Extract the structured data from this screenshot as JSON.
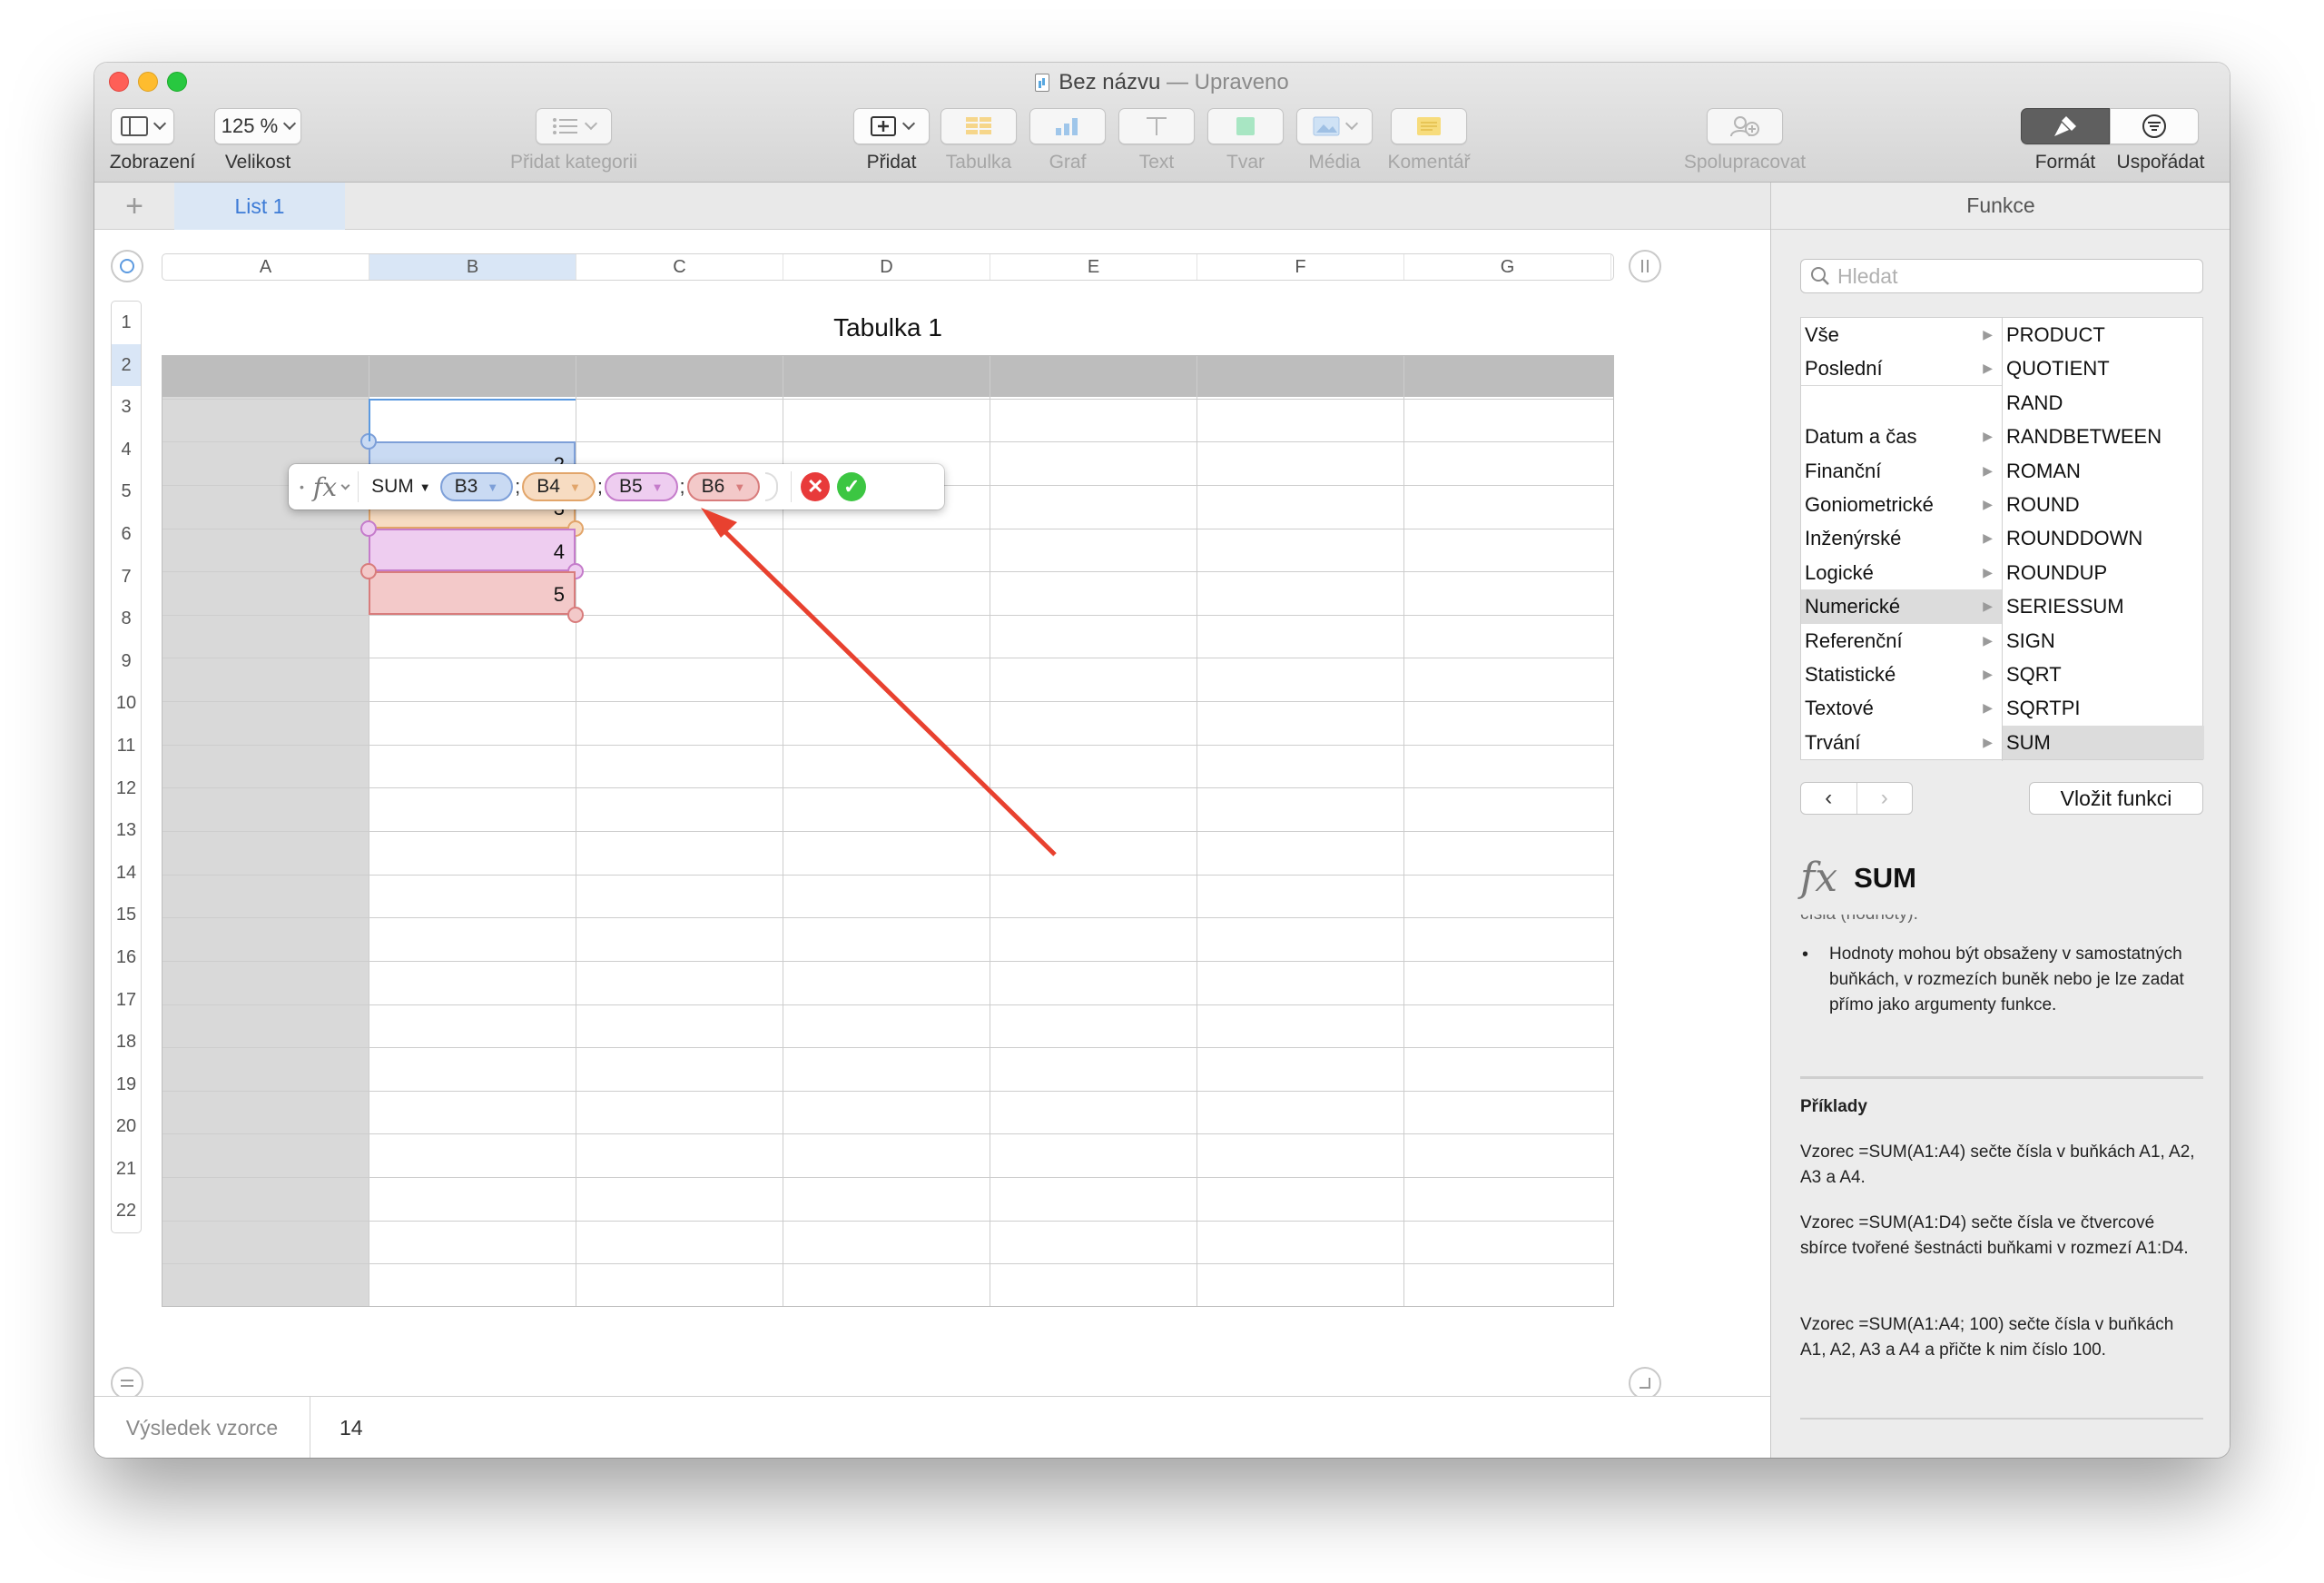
{
  "window": {
    "title": "Bez názvu",
    "title_sep": "—",
    "subtitle": "Upraveno"
  },
  "toolbar": {
    "zoom_value": "125 %",
    "labels": {
      "view": "Zobrazení",
      "zoom": "Velikost",
      "category": "Přidat kategorii",
      "insert": "Přidat",
      "table": "Tabulka",
      "chart": "Graf",
      "text": "Text",
      "shape": "Tvar",
      "media": "Média",
      "comment": "Komentář",
      "collaborate": "Spolupracovat",
      "format": "Formát",
      "organize": "Uspořádat"
    }
  },
  "sheets": {
    "add": "+",
    "active": "List 1"
  },
  "table": {
    "title": "Tabulka 1",
    "columns": [
      "A",
      "B",
      "C",
      "D",
      "E",
      "F",
      "G"
    ],
    "rows": [
      "1",
      "2",
      "3",
      "4",
      "5",
      "6",
      "7",
      "8",
      "9",
      "10",
      "11",
      "12",
      "13",
      "14",
      "15",
      "16",
      "17",
      "18",
      "19",
      "20",
      "21",
      "22"
    ],
    "values": {
      "B3": "2",
      "B4": "3",
      "B5": "4",
      "B6": "5"
    }
  },
  "formula_editor": {
    "dot": "•",
    "fx": "fx",
    "function": "SUM",
    "args": [
      {
        "ref": "B3",
        "color": "#c9daf3",
        "border": "#7d9fd8"
      },
      {
        "ref": "B4",
        "color": "#f7dcc2",
        "border": "#e2a56a"
      },
      {
        "ref": "B5",
        "color": "#eecdf0",
        "border": "#c57ccb"
      },
      {
        "ref": "B6",
        "color": "#f3c9c9",
        "border": "#d87c7c"
      }
    ],
    "separator": ";"
  },
  "statusbar": {
    "label": "Výsledek vzorce",
    "value": "14"
  },
  "panel": {
    "title": "Funkce",
    "search_placeholder": "Hledat",
    "categories": [
      "Vše",
      "Poslední",
      "",
      "Datum a čas",
      "Finanční",
      "Goniometrické",
      "Inženýrské",
      "Logické",
      "Numerické",
      "Referenční",
      "Statistické",
      "Textové",
      "Trvání"
    ],
    "functions": [
      "PRODUCT",
      "QUOTIENT",
      "RAND",
      "RANDBETWEEN",
      "ROMAN",
      "ROUND",
      "ROUNDDOWN",
      "ROUNDUP",
      "SERIESSUM",
      "SIGN",
      "SQRT",
      "SQRTPI",
      "SUM"
    ],
    "selected_category": "Numerické",
    "selected_function": "SUM",
    "nav_back": "‹",
    "nav_fwd": "›",
    "insert_button": "Vložit funkci",
    "fn_name": "SUM",
    "fn_fx": "fx",
    "cut_line": "čísla (hodnoty).",
    "bullet_text": "Hodnoty mohou být obsaženy v samostatných buňkách, v rozmezích buněk nebo je lze zadat přímo jako argumenty funkce.",
    "examples_heading": "Příklady",
    "examples": [
      "Vzorec =SUM(A1:A4) sečte čísla v buňkách A1, A2, A3 a A4.",
      "Vzorec =SUM(A1:D4) sečte čísla ve čtvercové sbírce tvořené šestnácti buňkami v rozmezí A1:D4.",
      "Vzorec =SUM(A1:A4; 100) sečte čísla v buňkách A1, A2, A3 a A4 a přičte k nim číslo 100."
    ]
  },
  "annotation": {
    "arrow_color": "#e8412f"
  }
}
